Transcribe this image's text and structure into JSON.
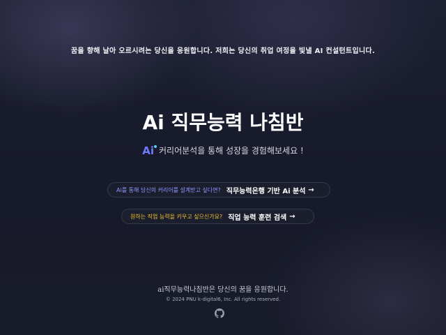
{
  "hero": {
    "tagline": "꿈을 향해 날아 오르시려는 당신을 응원합니다. 저희는 당신의 취업 여정을 빛낼 AI 컨설턴트입니다.",
    "title": "Ai 직무능력 나침반",
    "subtitle_logo": "Ai",
    "subtitle": "커리어분석을 통해 성장을 경험해보세요 !"
  },
  "links": [
    {
      "question": "Ai를 통해 당신의 커리어를 설계받고 싶다면?",
      "label": "직무능력은행 기반 Ai 분석",
      "arrow": "→"
    },
    {
      "question": "원하는 직업 능력을 키우고 싶으신가요?",
      "label": "직업 능력 훈련 검색",
      "arrow": "→"
    }
  ],
  "footer": {
    "slogan": "ai직무능력나침반은 당신의 꿈을 응원합니다.",
    "copyright": "© 2024 PNU k-digital6, Inc. All rights reserved.",
    "github_icon": "github-icon"
  },
  "colors": {
    "background": "#181b2b",
    "accent_blue": "#8e95ff",
    "accent_yellow": "#f1c232",
    "ai_logo": "#6f7bff"
  }
}
